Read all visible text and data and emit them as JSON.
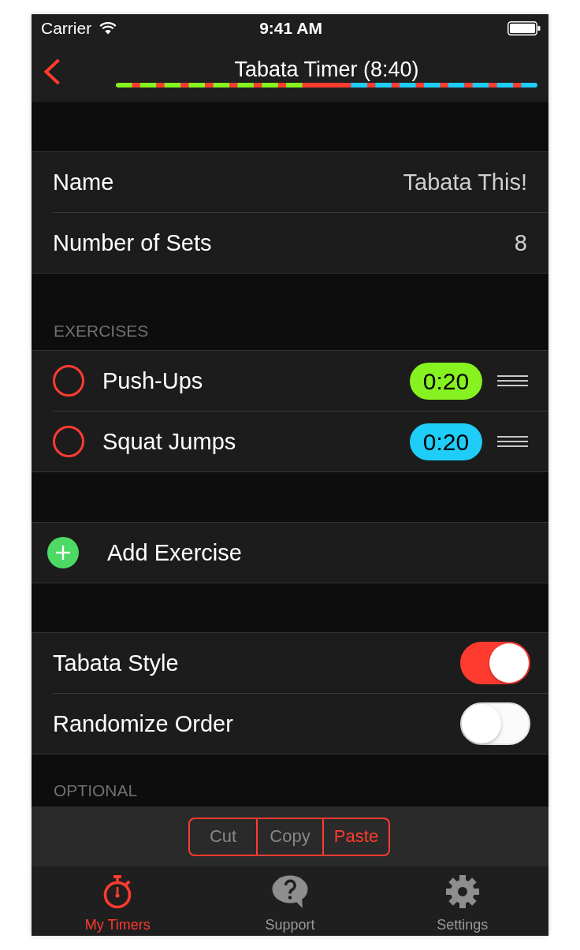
{
  "status_bar": {
    "carrier": "Carrier",
    "time": "9:41 AM"
  },
  "nav": {
    "title": "Tabata Timer (8:40)"
  },
  "settings": [
    {
      "label": "Name",
      "value": "Tabata This!"
    },
    {
      "label": "Number of Sets",
      "value": "8"
    }
  ],
  "exercises": {
    "header": "EXERCISES",
    "items": [
      {
        "name": "Push-Ups",
        "duration": "0:20",
        "color": "#86f21f",
        "selected": false
      },
      {
        "name": "Squat Jumps",
        "duration": "0:20",
        "color": "#1ecdf8",
        "selected": false
      }
    ]
  },
  "add_exercise": {
    "label": "Add Exercise"
  },
  "options": [
    {
      "label": "Tabata Style",
      "on": true
    },
    {
      "label": "Randomize Order",
      "on": false
    }
  ],
  "optional_header": "OPTIONAL",
  "edit_menu": [
    {
      "label": "Cut",
      "disabled": true
    },
    {
      "label": "Copy",
      "disabled": true
    },
    {
      "label": "Paste",
      "disabled": false
    }
  ],
  "tab_bar": [
    {
      "label": "My Timers",
      "selected": true
    },
    {
      "label": "Support",
      "selected": false
    },
    {
      "label": "Settings",
      "selected": false
    }
  ]
}
